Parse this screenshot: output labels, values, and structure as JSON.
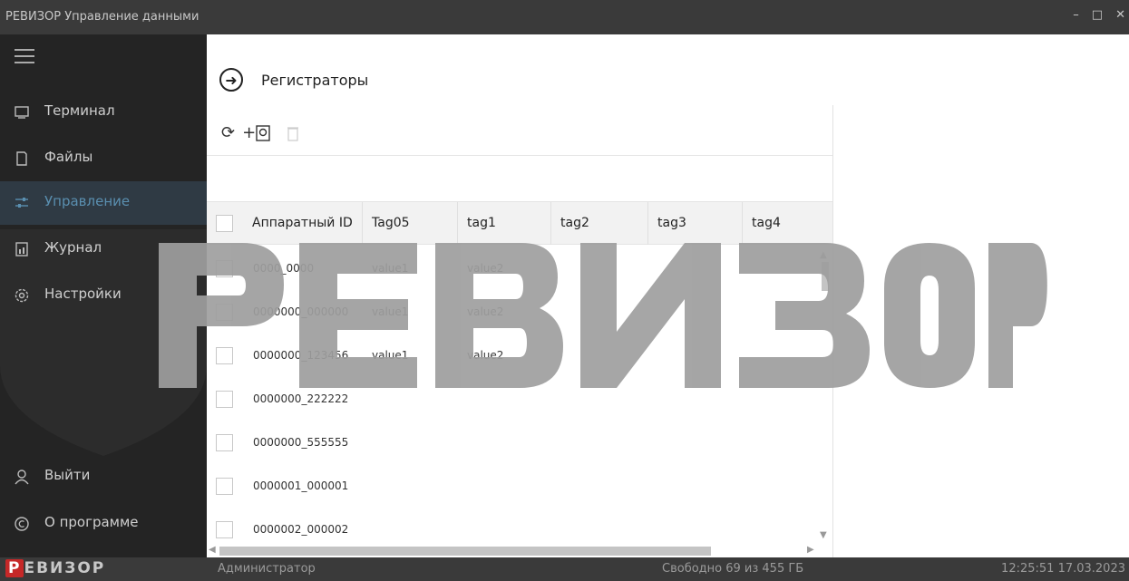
{
  "window": {
    "title": "РЕВИЗОР Управление данными",
    "controls": [
      "minimize-icon",
      "maximize-icon",
      "close-icon"
    ]
  },
  "sidebar": {
    "items": [
      {
        "label": "Терминал",
        "icon": "terminal-icon",
        "active": false
      },
      {
        "label": "Файлы",
        "icon": "file-icon",
        "active": false
      },
      {
        "label": "Управление",
        "icon": "sliders-icon",
        "active": true
      },
      {
        "label": "Журнал",
        "icon": "journal-icon",
        "active": false
      },
      {
        "label": "Настройки",
        "icon": "gear-icon",
        "active": false
      }
    ],
    "bottom": [
      {
        "label": "Выйти",
        "icon": "user-icon"
      },
      {
        "label": "О программе",
        "icon": "copyright-icon"
      }
    ]
  },
  "page": {
    "title": "Регистраторы",
    "back_icon": "arrow-right-icon"
  },
  "toolbar": {
    "refresh_icon": "refresh-icon",
    "add_label": "+",
    "add_icon": "add-device-icon",
    "delete_icon": "trash-icon"
  },
  "table": {
    "columns": [
      "Аппаратный ID",
      "Tag05",
      "tag1",
      "tag2",
      "tag3",
      "tag4"
    ],
    "rows": [
      {
        "id": "0000_0000",
        "tag05": "value1",
        "tag1": "value2"
      },
      {
        "id": "0000000_000000",
        "tag05": "value1",
        "tag1": "value2"
      },
      {
        "id": "0000000_123456",
        "tag05": "value1",
        "tag1": "value2"
      },
      {
        "id": "0000000_222222",
        "tag05": "",
        "tag1": ""
      },
      {
        "id": "0000000_555555",
        "tag05": "",
        "tag1": ""
      },
      {
        "id": "0000001_000001",
        "tag05": "",
        "tag1": ""
      },
      {
        "id": "0000002_000002",
        "tag05": "",
        "tag1": ""
      }
    ]
  },
  "watermark": "РЕВИЗОР",
  "status": {
    "logo_p": "Р",
    "logo_rest": "ЕВИЗОР",
    "user": "Администратор",
    "space": "Свободно 69 из 455 ГБ",
    "datetime": "12:25:51 17.03.2023"
  },
  "colors": {
    "titlebar": "#3a3a3a",
    "sidebar": "#242424",
    "active_item": "#2f3a44",
    "accent": "#5a8fb0",
    "logo_red": "#c62828",
    "watermark": "#9e9e9e"
  }
}
